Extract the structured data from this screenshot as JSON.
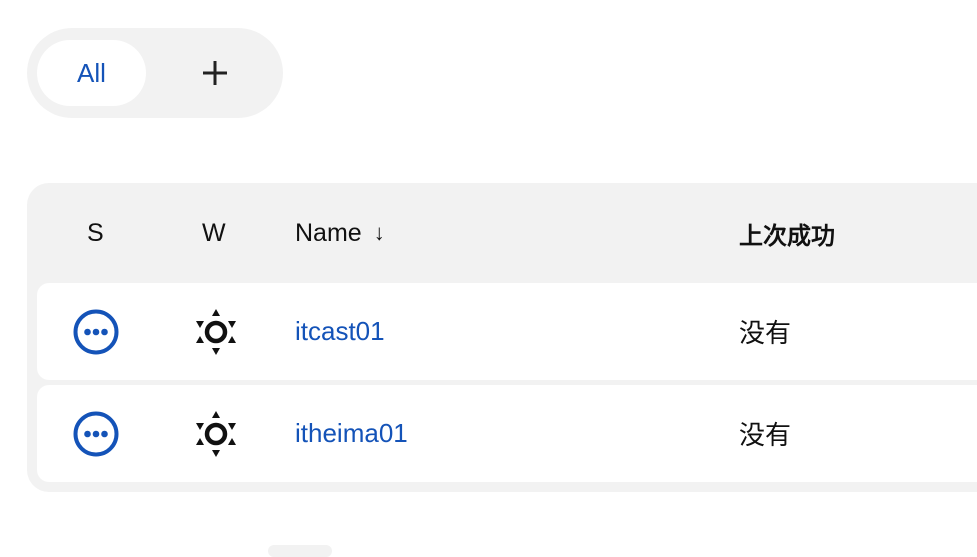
{
  "view_tabs": {
    "all_label": "All",
    "add_label": "+"
  },
  "table": {
    "columns": {
      "status": "S",
      "weather": "W",
      "name": "Name",
      "name_sort_indicator": "↓",
      "last_success": "上次成功"
    },
    "rows": [
      {
        "status_icon": "in-progress-dots-icon",
        "weather_icon": "sunny-weather-icon",
        "name": "itcast01",
        "last_success": "没有"
      },
      {
        "status_icon": "in-progress-dots-icon",
        "weather_icon": "sunny-weather-icon",
        "name": "itheima01",
        "last_success": "没有"
      }
    ]
  },
  "colors": {
    "accent": "#1453b8",
    "panel_bg": "#f2f2f2",
    "text": "#111111"
  }
}
